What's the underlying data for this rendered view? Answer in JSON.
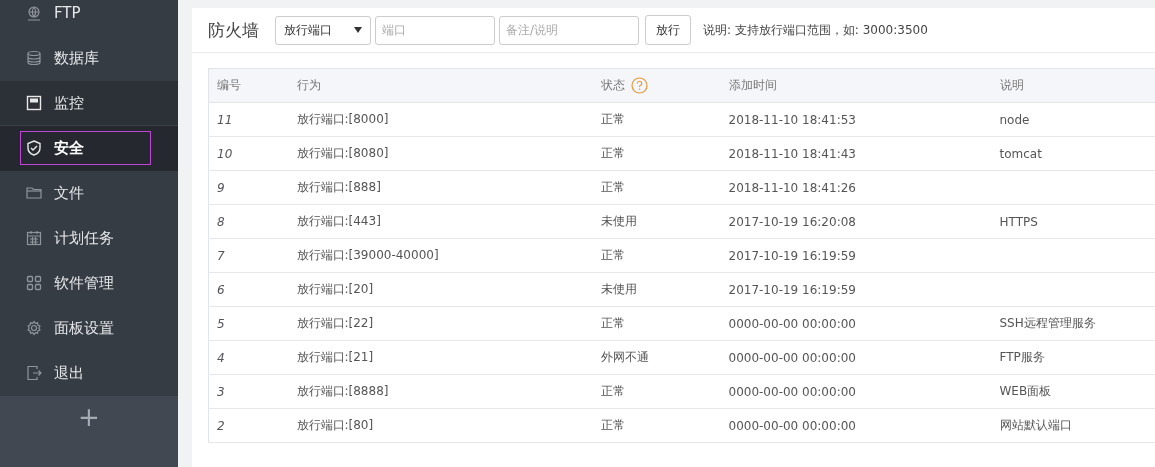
{
  "sidebar": {
    "items": [
      {
        "label": "FTP",
        "selected": false,
        "hovered": false,
        "highlighted": false
      },
      {
        "label": "数据库",
        "selected": false,
        "hovered": false,
        "highlighted": false
      },
      {
        "label": "监控",
        "selected": false,
        "hovered": true,
        "highlighted": false
      },
      {
        "label": "安全",
        "selected": true,
        "hovered": false,
        "highlighted": true
      },
      {
        "label": "文件",
        "selected": false,
        "hovered": false,
        "highlighted": false
      },
      {
        "label": "计划任务",
        "selected": false,
        "hovered": false,
        "highlighted": false
      },
      {
        "label": "软件管理",
        "selected": false,
        "hovered": false,
        "highlighted": false
      },
      {
        "label": "面板设置",
        "selected": false,
        "hovered": false,
        "highlighted": false
      },
      {
        "label": "退出",
        "selected": false,
        "hovered": false,
        "highlighted": false
      }
    ],
    "add_button": "+"
  },
  "firewall": {
    "title": "防火墙",
    "type_select": "放行端口",
    "port_field": {
      "placeholder": "端口"
    },
    "note_field": {
      "placeholder": "备注/说明"
    },
    "submit_button": "放行",
    "hint": "说明: 支持放行端口范围，如: 3000:3500"
  },
  "table": {
    "columns": [
      "编号",
      "行为",
      "状态",
      "添加时间",
      "说明"
    ],
    "rows": [
      {
        "id": "11",
        "action": "放行端口:[8000]",
        "status": "正常",
        "time": "2018-11-10 18:41:53",
        "note": "node"
      },
      {
        "id": "10",
        "action": "放行端口:[8080]",
        "status": "正常",
        "time": "2018-11-10 18:41:43",
        "note": "tomcat"
      },
      {
        "id": "9",
        "action": "放行端口:[888]",
        "status": "正常",
        "time": "2018-11-10 18:41:26"
      },
      {
        "id": "8",
        "action": "放行端口:[443]",
        "status": "未使用",
        "time": "2017-10-19 16:20:08",
        "note": "HTTPS"
      },
      {
        "id": "7",
        "action": "放行端口:[39000-40000]",
        "status": "正常",
        "time": "2017-10-19 16:19:59"
      },
      {
        "id": "6",
        "action": "放行端口:[20]",
        "status": "未使用",
        "time": "2017-10-19 16:19:59"
      },
      {
        "id": "5",
        "action": "放行端口:[22]",
        "status": "正常",
        "time": "0000-00-00 00:00:00",
        "note": "SSH远程管理服务"
      },
      {
        "id": "4",
        "action": "放行端口:[21]",
        "status": "外网不通",
        "time": "0000-00-00 00:00:00",
        "note": "FTP服务"
      },
      {
        "id": "3",
        "action": "放行端口:[8888]",
        "status": "正常",
        "time": "0000-00-00 00:00:00",
        "note": "WEB面板"
      },
      {
        "id": "2",
        "action": "放行端口:[80]",
        "status": "正常",
        "time": "0000-00-00 00:00:00",
        "note": "网站默认端口"
      }
    ]
  }
}
